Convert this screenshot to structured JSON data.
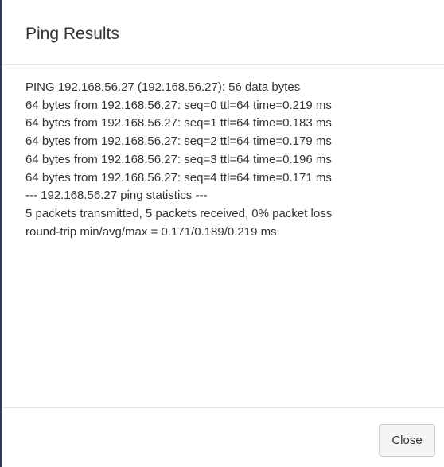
{
  "dialog": {
    "title": "Ping Results",
    "output": [
      "PING 192.168.56.27 (192.168.56.27): 56 data bytes",
      "64 bytes from 192.168.56.27: seq=0 ttl=64 time=0.219 ms",
      "64 bytes from 192.168.56.27: seq=1 ttl=64 time=0.183 ms",
      "64 bytes from 192.168.56.27: seq=2 ttl=64 time=0.179 ms",
      "64 bytes from 192.168.56.27: seq=3 ttl=64 time=0.196 ms",
      "64 bytes from 192.168.56.27: seq=4 ttl=64 time=0.171 ms",
      "--- 192.168.56.27 ping statistics ---",
      "5 packets transmitted, 5 packets received, 0% packet loss",
      "round-trip min/avg/max = 0.171/0.189/0.219 ms"
    ],
    "close_label": "Close"
  }
}
